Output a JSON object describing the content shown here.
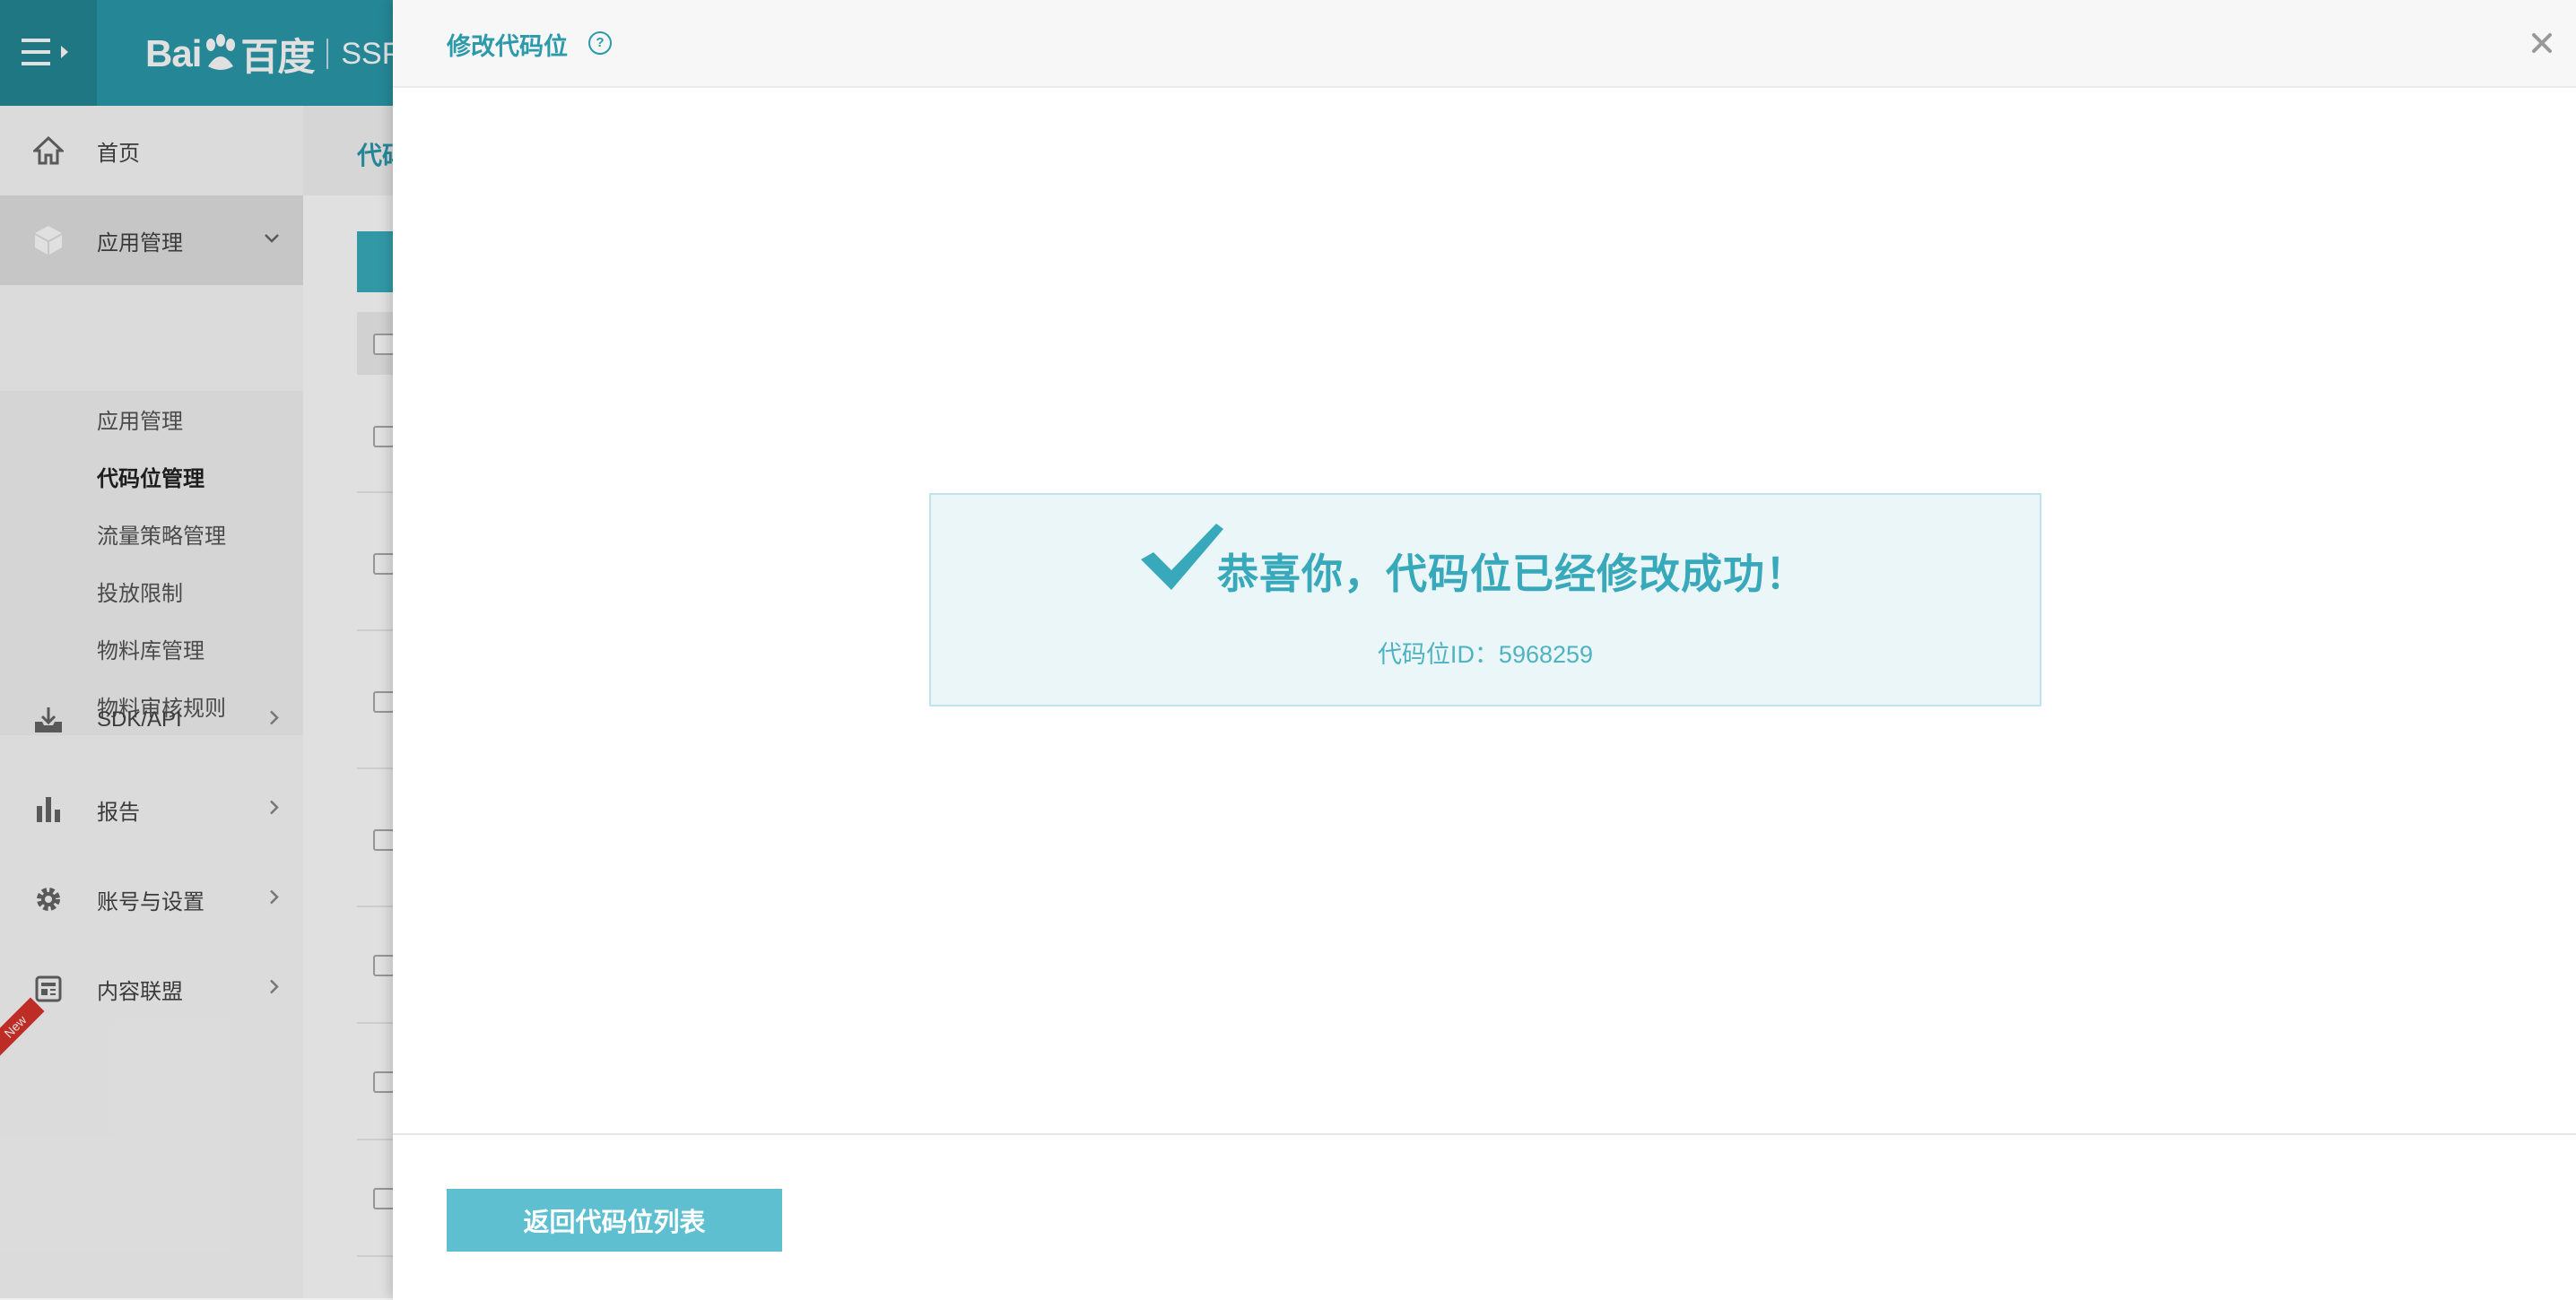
{
  "header": {
    "logo_brand": "Bai",
    "logo_brand_suffix": "百度",
    "logo_product": "SSP"
  },
  "sidebar": {
    "items": [
      {
        "label": "首页",
        "icon": "home-icon"
      },
      {
        "label": "应用管理",
        "icon": "cube-icon",
        "expanded": true
      },
      {
        "label": "SDK/API",
        "icon": "download-icon"
      },
      {
        "label": "报告",
        "icon": "bar-chart-icon"
      },
      {
        "label": "账号与设置",
        "icon": "gear-icon"
      },
      {
        "label": "内容联盟",
        "icon": "newspaper-icon"
      }
    ],
    "submenu": [
      {
        "label": "应用管理"
      },
      {
        "label": "代码位管理",
        "current": true
      },
      {
        "label": "流量策略管理"
      },
      {
        "label": "投放限制"
      },
      {
        "label": "物料库管理"
      },
      {
        "label": "物料审核规则"
      }
    ],
    "new_badge": "New"
  },
  "main": {
    "breadcrumb": "代码"
  },
  "dialog": {
    "title": "修改代码位",
    "help_symbol": "?",
    "success_message": "恭喜你，代码位已经修改成功！",
    "slot_id_text": "代码位ID：5968259",
    "back_button": "返回代码位列表"
  },
  "colors": {
    "accent": "#2b9aab",
    "button": "#5dbfd0",
    "success_bg": "#eaf6f8"
  }
}
